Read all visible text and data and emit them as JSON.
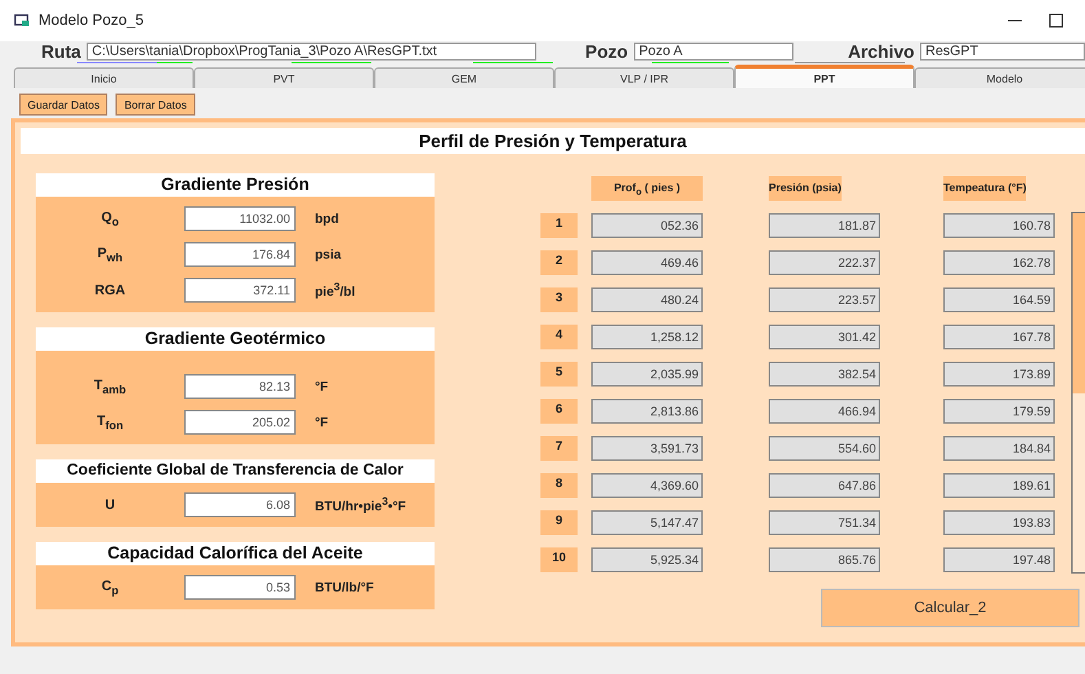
{
  "window": {
    "title": "Modelo Pozo_5"
  },
  "path_bar": {
    "fields": [
      {
        "label": "Ruta",
        "value": "C:\\Users\\tania\\Dropbox\\ProgTania_3\\Pozo A\\ResGPT.txt"
      },
      {
        "label": "Pozo",
        "value": "Pozo A"
      },
      {
        "label": "Archivo",
        "value": "ResGPT"
      }
    ]
  },
  "tabs": [
    {
      "label": "Inicio",
      "selected": false
    },
    {
      "label": "PVT",
      "selected": false
    },
    {
      "label": "GEM",
      "selected": false
    },
    {
      "label": "VLP / IPR",
      "selected": false
    },
    {
      "label": "PPT",
      "selected": true
    },
    {
      "label": "Modelo",
      "selected": false
    }
  ],
  "toolbar": [
    "Guardar Datos",
    "Borrar Datos"
  ],
  "panel_title": "Perfil  de  Presión  y  Temperatura",
  "sections": [
    {
      "title": "Gradiente Presión",
      "fields": [
        {
          "label": "Q$_{o}$",
          "value": "11032.00",
          "unit": "bpd"
        },
        {
          "label": "P$_{wh}$",
          "value": "176.84",
          "unit": "psia"
        },
        {
          "label": "RGA",
          "value": "372.11",
          "unit": "pie$^{3}$/bl"
        }
      ]
    },
    {
      "title": "Gradiente Geotérmico",
      "fields": [
        {
          "label": "T$_{amb}$",
          "value": "82.13",
          "unit": "°F"
        },
        {
          "label": "T$_{fon}$",
          "value": "205.02",
          "unit": "°F"
        }
      ]
    },
    {
      "title": "Coeficiente Global de Transferencia de Calor",
      "fields": [
        {
          "label": "U",
          "value": "6.08",
          "unit": "BTU/hr•pie$^{3}$•°F"
        }
      ]
    },
    {
      "title": "Capacidad Calorífica del Aceite",
      "fields": [
        {
          "label": "C$_{p}$",
          "value": "0.53",
          "unit": "BTU/lb/°F"
        }
      ]
    }
  ],
  "table": {
    "columns": [
      "Prof$_{o}$  ( pies )",
      "Presión  (psia)",
      "Tempeatura  (°F)"
    ],
    "rows": [
      {
        "index": "1",
        "cells": [
          "052.36",
          "181.87",
          "160.78"
        ]
      },
      {
        "index": "2",
        "cells": [
          "469.46",
          "222.37",
          "162.78"
        ]
      },
      {
        "index": "3",
        "cells": [
          "480.24",
          "223.57",
          "164.59"
        ]
      },
      {
        "index": "4",
        "cells": [
          "1,258.12",
          "301.42",
          "167.78"
        ]
      },
      {
        "index": "5",
        "cells": [
          "2,035.99",
          "382.54",
          "173.89"
        ]
      },
      {
        "index": "6",
        "cells": [
          "2,813.86",
          "466.94",
          "179.59"
        ]
      },
      {
        "index": "7",
        "cells": [
          "3,591.73",
          "554.60",
          "184.84"
        ]
      },
      {
        "index": "8",
        "cells": [
          "4,369.60",
          "647.86",
          "189.61"
        ]
      },
      {
        "index": "9",
        "cells": [
          "5,147.47",
          "751.34",
          "193.83"
        ]
      },
      {
        "index": "10",
        "cells": [
          "5,925.34",
          "865.76",
          "197.48"
        ]
      }
    ]
  },
  "calculate_button": "Calcular_2"
}
